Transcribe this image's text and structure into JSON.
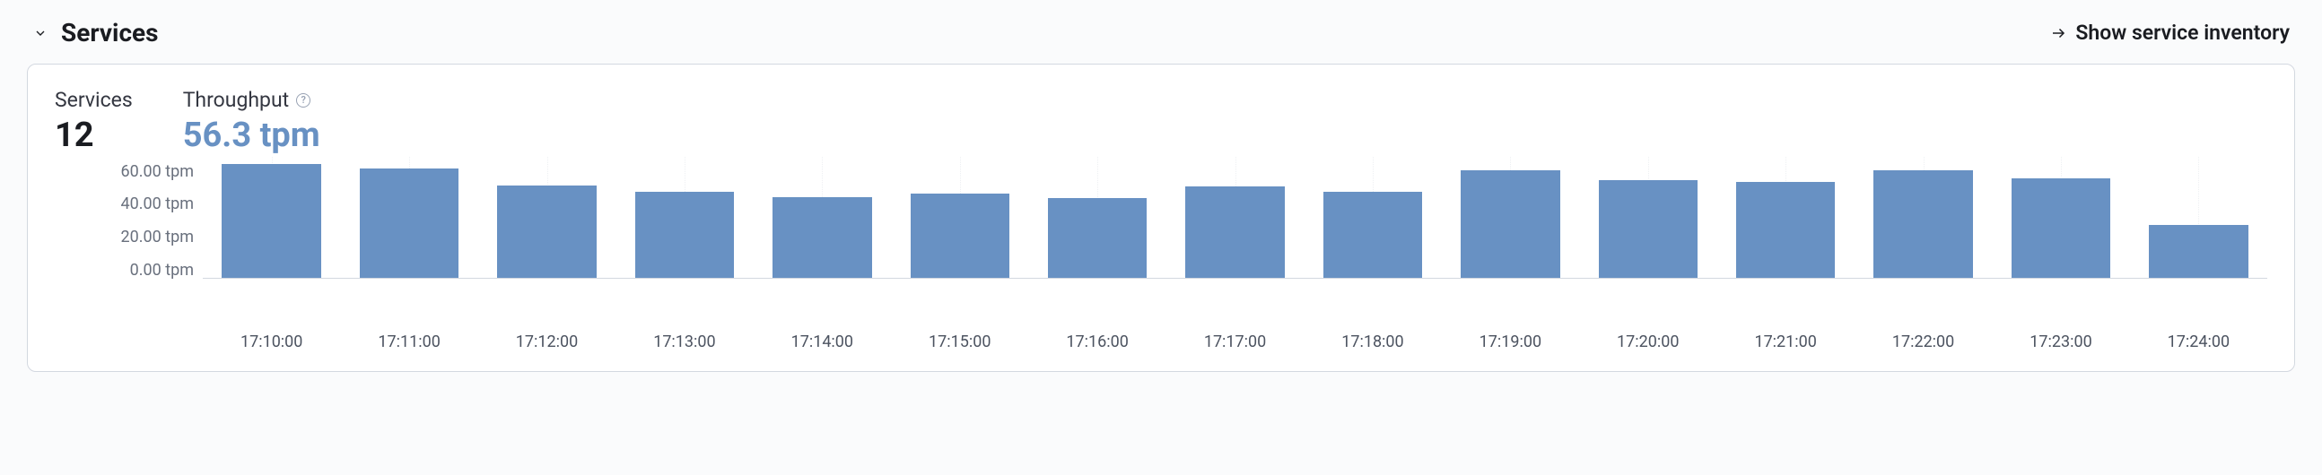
{
  "header": {
    "title": "Services",
    "link_label": "Show service inventory"
  },
  "stats": {
    "services_label": "Services",
    "services_value": "12",
    "throughput_label": "Throughput",
    "throughput_value": "56.3 tpm"
  },
  "chart_data": {
    "type": "bar",
    "title": "Throughput",
    "ylabel": "tpm",
    "xlabel": "",
    "ylim": [
      0,
      70
    ],
    "y_ticks": [
      "60.00 tpm",
      "40.00 tpm",
      "20.00 tpm",
      "0.00 tpm"
    ],
    "categories": [
      "17:10:00",
      "17:11:00",
      "17:12:00",
      "17:13:00",
      "17:14:00",
      "17:15:00",
      "17:16:00",
      "17:17:00",
      "17:18:00",
      "17:19:00",
      "17:20:00",
      "17:21:00",
      "17:22:00",
      "17:23:00",
      "17:24:00"
    ],
    "values": [
      69,
      66,
      56,
      52,
      49,
      51,
      48,
      55,
      52,
      65,
      59,
      58,
      65,
      60,
      32
    ],
    "bar_color": "#6891c3"
  }
}
